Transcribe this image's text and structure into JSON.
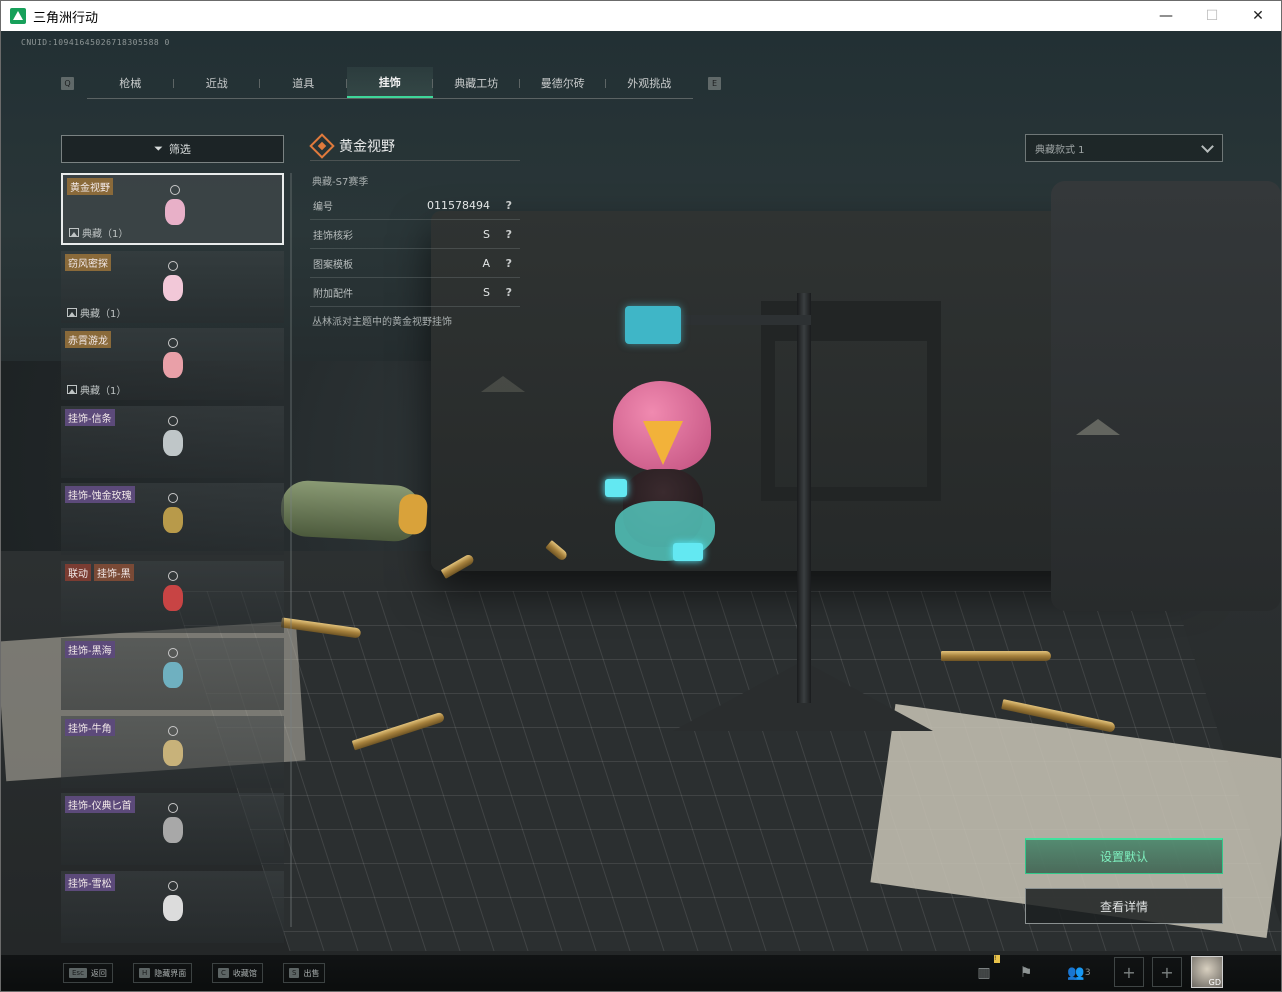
{
  "window": {
    "title": "三角洲行动",
    "minimize": "—",
    "maximize": "☐",
    "close": "✕"
  },
  "cnuid": "CNUID:10941645026718305588 0",
  "tabs": {
    "left_key": "Q",
    "right_key": "E",
    "items": [
      {
        "label": "枪械"
      },
      {
        "label": "近战"
      },
      {
        "label": "道具"
      },
      {
        "label": "挂饰",
        "active": true
      },
      {
        "label": "典藏工坊"
      },
      {
        "label": "曼德尔砖"
      },
      {
        "label": "外观挑战"
      }
    ]
  },
  "filter": {
    "label": "筛选",
    "icon": "filter-icon"
  },
  "list": {
    "items": [
      {
        "tags": [
          {
            "text": "黄金视野",
            "color": "gold"
          }
        ],
        "count": "典藏（1）",
        "thumb": "#e8b0c8"
      },
      {
        "tags": [
          {
            "text": "窃风密探",
            "color": "gold"
          }
        ],
        "count": "典藏（1）",
        "thumb": "#f2c8d8"
      },
      {
        "tags": [
          {
            "text": "赤霄游龙",
            "color": "gold"
          }
        ],
        "count": "典藏（1）",
        "thumb": "#e9a0a8"
      },
      {
        "tags": [
          {
            "text": "挂饰-信条",
            "color": "purple"
          }
        ],
        "count": "",
        "thumb": "#bfc6c8"
      },
      {
        "tags": [
          {
            "text": "挂饰-蚀金玫瑰",
            "color": "purple"
          }
        ],
        "count": "",
        "thumb": "#b89a4a"
      },
      {
        "tags": [
          {
            "text": "联动",
            "color": "red"
          },
          {
            "text": "挂饰-黑",
            "color": "brown"
          }
        ],
        "count": "",
        "thumb": "#c84444"
      },
      {
        "tags": [
          {
            "text": "挂饰-黑海",
            "color": "purple"
          }
        ],
        "count": "",
        "thumb": "#6fb0c0"
      },
      {
        "tags": [
          {
            "text": "挂饰-牛角",
            "color": "purple"
          }
        ],
        "count": "",
        "thumb": "#c8b27a"
      },
      {
        "tags": [
          {
            "text": "挂饰-仪典匕首",
            "color": "purple"
          }
        ],
        "count": "",
        "thumb": "#a8a8a8"
      },
      {
        "tags": [
          {
            "text": "挂饰-雪松",
            "color": "purple"
          }
        ],
        "count": "",
        "thumb": "#dcdcdc"
      }
    ]
  },
  "detail": {
    "title": "黄金视野",
    "subtitle": "典藏-S7赛季",
    "rows": [
      {
        "label": "编号",
        "value": "011578494",
        "help": "?"
      },
      {
        "label": "挂饰核彩",
        "value": "S",
        "help": "?"
      },
      {
        "label": "图案模板",
        "value": "A",
        "help": "?"
      },
      {
        "label": "附加配件",
        "value": "S",
        "help": "?"
      }
    ],
    "description": "丛林派对主题中的黄金视野挂饰"
  },
  "style_select": {
    "value": "典藏款式 1"
  },
  "actions": {
    "set_default": "设置默认",
    "view_details": "查看详情"
  },
  "bottom_hints": [
    {
      "key": "Esc",
      "label": "返回"
    },
    {
      "key": "H",
      "label": "隐藏界面"
    },
    {
      "key": "C",
      "label": "收藏馆"
    },
    {
      "key": "S",
      "label": "出售"
    }
  ],
  "status": {
    "friends_count": "3",
    "avatar_level": "GD",
    "notice_badge": "!"
  },
  "colors": {
    "accent_green": "#3ed79a",
    "diamond_orange": "#e07a3c",
    "tag_gold": "#8a6a3a",
    "tag_purple": "#5c4a7a"
  }
}
